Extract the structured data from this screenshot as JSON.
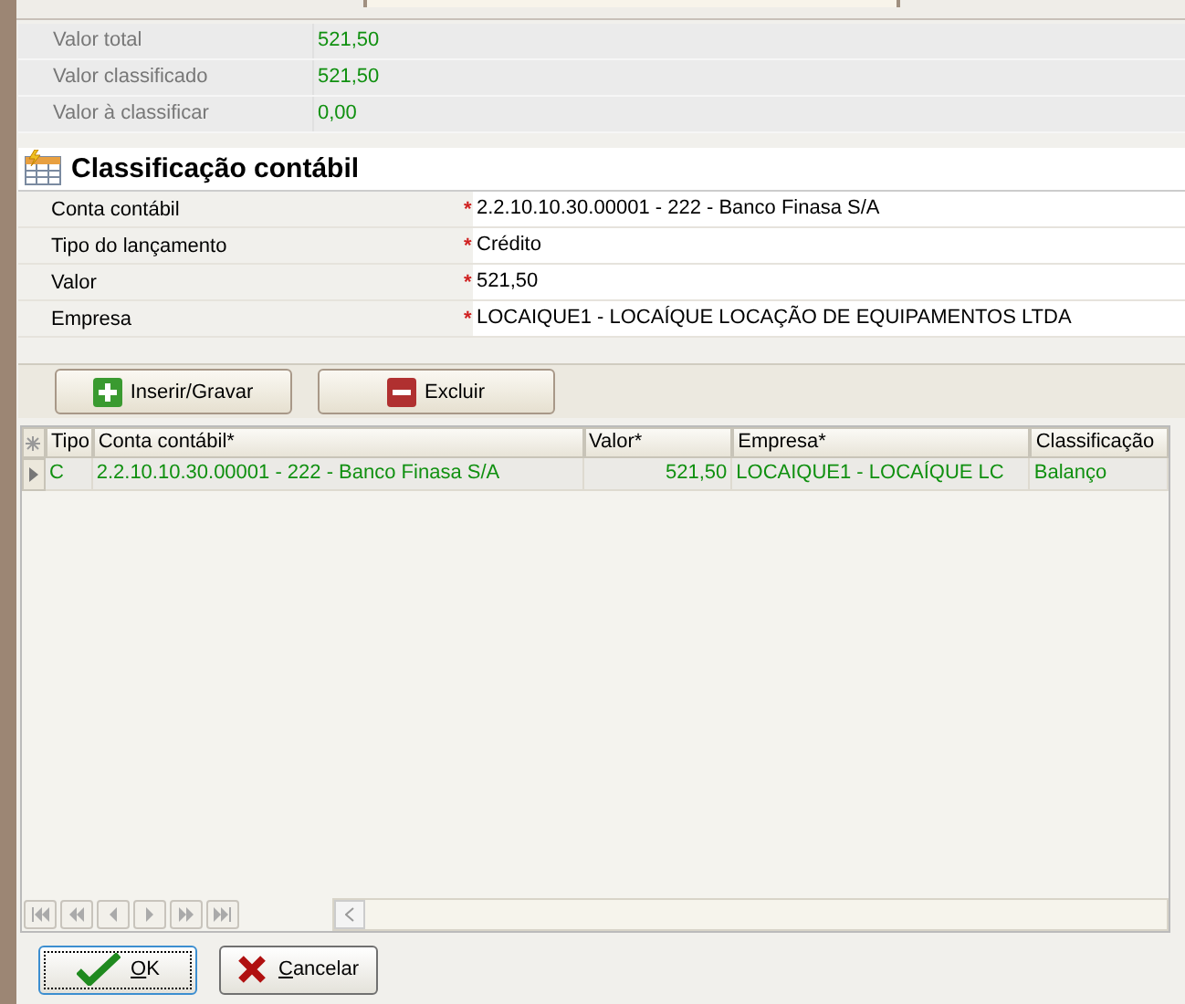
{
  "summary": [
    {
      "label": "Valor total",
      "value": "521,50"
    },
    {
      "label": "Valor classificado",
      "value": "521,50"
    },
    {
      "label": "Valor à classificar",
      "value": "0,00"
    }
  ],
  "section": {
    "title": "Classificação contábil"
  },
  "form": [
    {
      "label": "Conta contábil",
      "required_mark": "*",
      "value": "2.2.10.10.30.00001 - 222 - Banco Finasa S/A"
    },
    {
      "label": "Tipo do lançamento",
      "required_mark": "*",
      "value": "Crédito"
    },
    {
      "label": "Valor",
      "required_mark": "*",
      "value": "521,50"
    },
    {
      "label": "Empresa",
      "required_mark": "*",
      "value": "LOCAIQUE1 - LOCAÍQUE LOCAÇÃO DE EQUIPAMENTOS LTDA"
    }
  ],
  "actions": [
    {
      "label": "Inserir/Gravar",
      "kind": "add"
    },
    {
      "label": "Excluir",
      "kind": "remove"
    }
  ],
  "grid": {
    "columns": [
      "Tipo",
      "Conta contábil*",
      "Valor*",
      "Empresa*",
      "Classificação"
    ],
    "rows": [
      {
        "selected": true,
        "cells": [
          "C",
          "2.2.10.10.30.00001 - 222 - Banco Finasa S/A",
          "521,50",
          "LOCAIQUE1 - LOCAÍQUE LC",
          "Balanço"
        ]
      }
    ]
  },
  "buttons": [
    {
      "label": "OK",
      "kind": "ok",
      "focused": true
    },
    {
      "label": "Cancelar",
      "kind": "cancel",
      "focused": false
    }
  ]
}
